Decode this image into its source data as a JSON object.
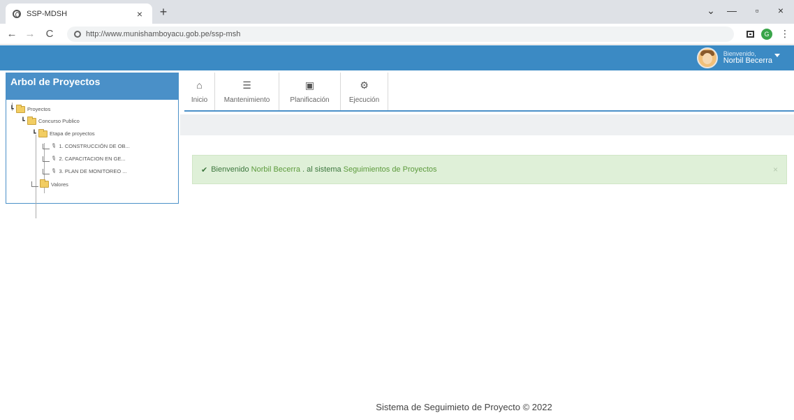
{
  "browser": {
    "tab_title": "SSP-MDSH",
    "tab_close": "×",
    "new_tab": "+",
    "url": "http://www.munishamboyacu.gob.pe/ssp-msh",
    "profile_initial": "G",
    "controls": {
      "chevron": "⌄",
      "minimize": "—",
      "maximize": "▫",
      "close": "×"
    },
    "nav": {
      "back": "←",
      "forward": "→",
      "reload": "C",
      "menu": "⋮"
    }
  },
  "header": {
    "welcome": "Bienvenido,",
    "user_name": "Norbil Becerra"
  },
  "sidebar": {
    "title": "Arbol de Proyectos",
    "tree": {
      "root": "Proyectos",
      "level1": "Concurso Publico",
      "level2": "Etapa de proyectos",
      "items": [
        "1. CONSTRUCCIÓN DE OB...",
        "2. CAPACITACION EN GE...",
        "3. PLAN DE MONITOREO ..."
      ],
      "valores": "Valores"
    }
  },
  "toolbar": {
    "items": [
      {
        "icon": "home-icon",
        "glyph": "⌂",
        "label": "Inicio"
      },
      {
        "icon": "database-icon",
        "glyph": "☰",
        "label": "Mantenimiento"
      },
      {
        "icon": "briefcase-icon",
        "glyph": "▣",
        "label": "Planificación"
      },
      {
        "icon": "gears-icon",
        "glyph": "⚙",
        "label": "Ejecución"
      }
    ]
  },
  "alert": {
    "check": "✔",
    "prefix": "Bienvenido",
    "user": "Norbil Becerra",
    "middle": ". al sistema",
    "system": "Seguimientos de Proyectos",
    "close": "×"
  },
  "footer": {
    "text": "Sistema de Seguimieto de Proyecto © 2022"
  },
  "colors": {
    "header_blue": "#3b8ac4",
    "sidebar_blue": "#4a90c8",
    "alert_bg": "#dff0d8",
    "alert_text": "#3c763d"
  }
}
